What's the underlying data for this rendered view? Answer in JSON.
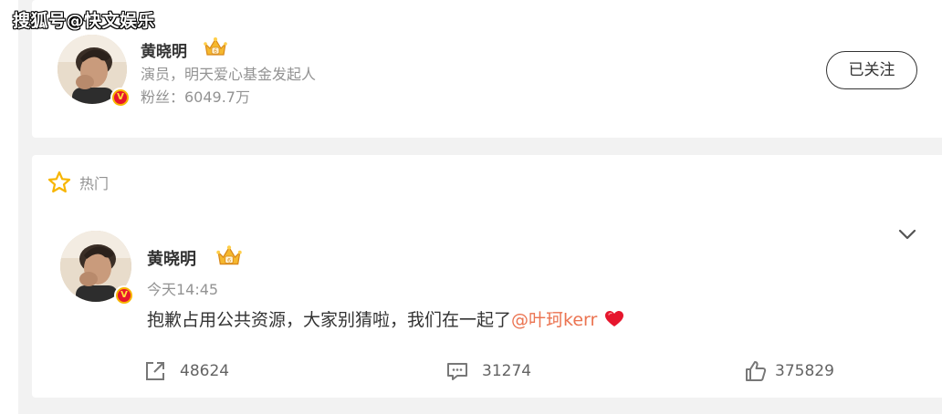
{
  "watermark": "搜狐号@快文娱乐",
  "profile": {
    "name": "黄晓明",
    "description": "演员，明天爱心基金发起人",
    "followers": "粉丝：6049.7万",
    "follow_button_label": "已关注",
    "verified_mark": "V"
  },
  "post": {
    "section_label": "热门",
    "author_name": "黄晓明",
    "time": "今天14:45",
    "text": "抱歉占用公共资源，大家别猜啦，我们在一起了",
    "mention": "@叶珂kerr",
    "verified_mark": "V",
    "stats": {
      "reposts": "48624",
      "comments": "31274",
      "likes": "375829"
    }
  },
  "colors": {
    "accent_mention": "#eb7350",
    "verified_badge": "#f7b500",
    "heart": "#e6162d",
    "text_primary": "#333333",
    "text_secondary": "#939393"
  },
  "icons": [
    "crown-icon",
    "star-icon",
    "chevron-down-icon",
    "heart-icon",
    "repost-icon",
    "comment-icon",
    "like-icon"
  ]
}
